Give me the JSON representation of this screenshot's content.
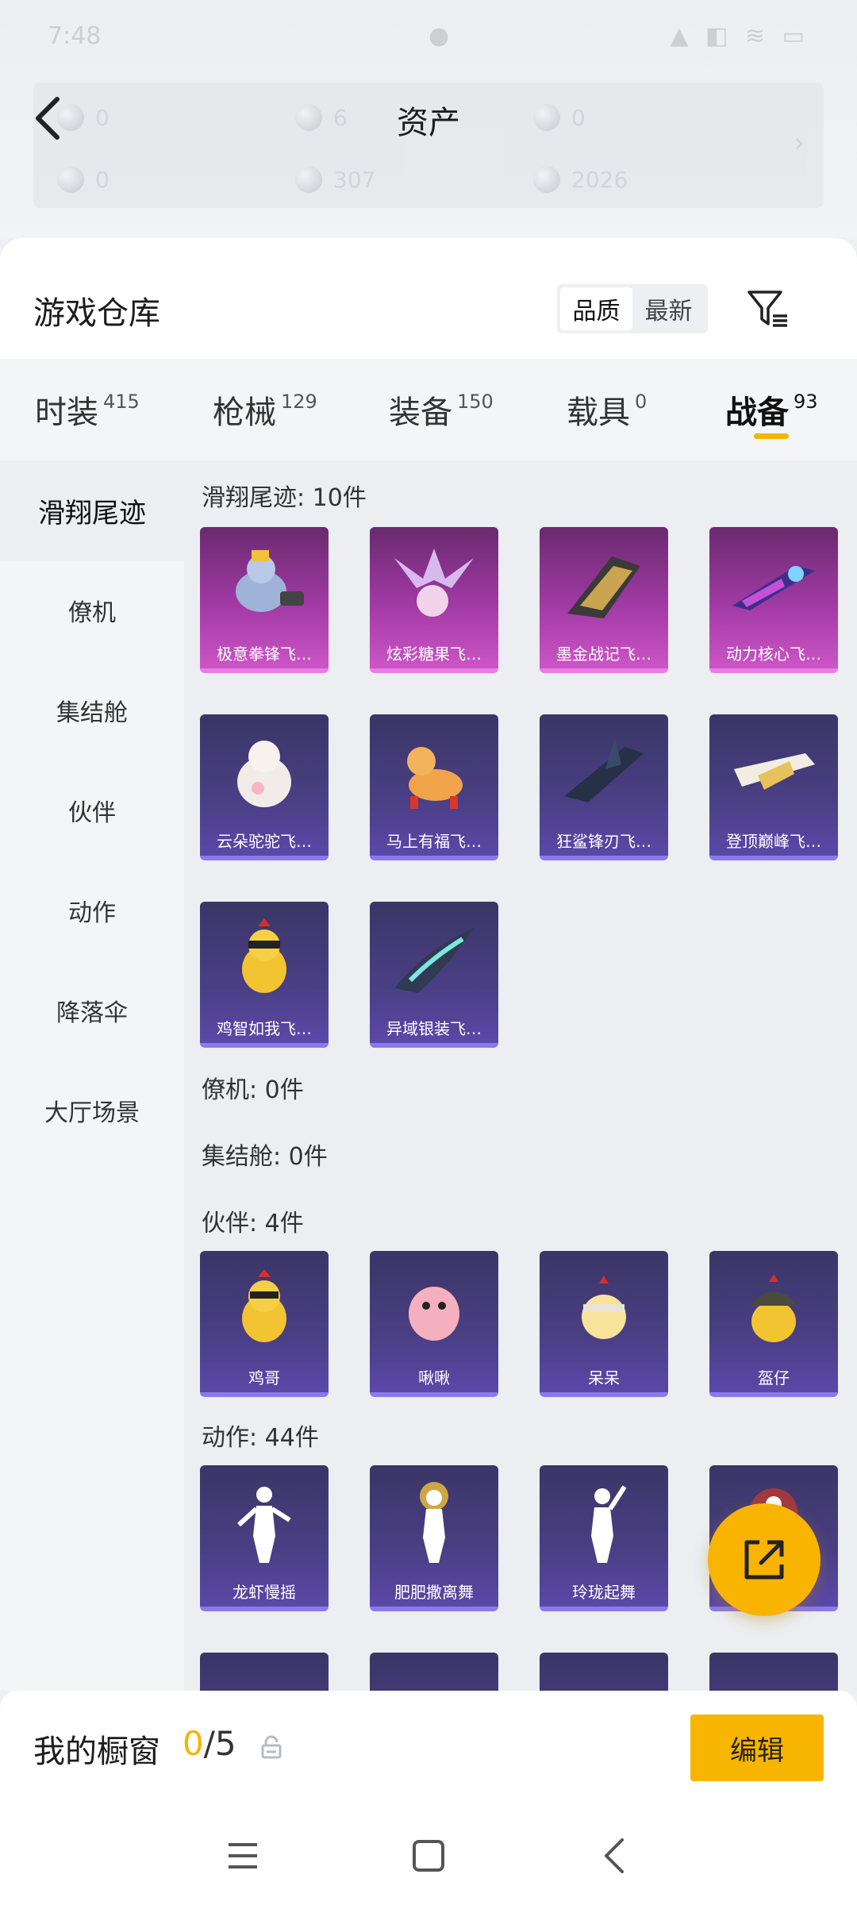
{
  "header": {
    "title": "资产",
    "assets": [
      {
        "value": "0"
      },
      {
        "value": "6"
      },
      {
        "value": "0"
      },
      {
        "value": "0"
      },
      {
        "value": "307"
      },
      {
        "value": "2026"
      }
    ]
  },
  "warehouse": {
    "title": "游戏仓库",
    "sort_options": [
      "品质",
      "最新"
    ],
    "sort_active": "品质"
  },
  "tabs": [
    {
      "label": "时装",
      "count": "415"
    },
    {
      "label": "枪械",
      "count": "129"
    },
    {
      "label": "装备",
      "count": "150"
    },
    {
      "label": "载具",
      "count": "0"
    },
    {
      "label": "战备",
      "count": "93"
    }
  ],
  "sidebar": [
    {
      "label": "滑翔尾迹"
    },
    {
      "label": "僚机"
    },
    {
      "label": "集结舱"
    },
    {
      "label": "伙伴"
    },
    {
      "label": "动作"
    },
    {
      "label": "降落伞"
    },
    {
      "label": "大厅场景"
    }
  ],
  "sections": {
    "trails": {
      "title": "滑翔尾迹: 10件",
      "items": [
        {
          "name": "极意拳锋飞…"
        },
        {
          "name": "炫彩糖果飞…"
        },
        {
          "name": "墨金战记飞…"
        },
        {
          "name": "动力核心飞…"
        },
        {
          "name": "云朵驼驼飞…"
        },
        {
          "name": "马上有福飞…"
        },
        {
          "name": "狂鲨锋刃飞…"
        },
        {
          "name": "登顶巅峰飞…"
        },
        {
          "name": "鸡智如我飞…"
        },
        {
          "name": "异域银装飞…"
        }
      ]
    },
    "wingman": {
      "title": "僚机: 0件"
    },
    "capsule": {
      "title": "集结舱: 0件"
    },
    "partners": {
      "title": "伙伴: 4件",
      "items": [
        {
          "name": "鸡哥"
        },
        {
          "name": "啾啾"
        },
        {
          "name": "呆呆"
        },
        {
          "name": "盔仔"
        }
      ]
    },
    "emotes": {
      "title": "动作: 44件",
      "items": [
        {
          "name": "龙虾慢摇"
        },
        {
          "name": "肥肥撒离舞"
        },
        {
          "name": "玲珑起舞"
        },
        {
          "name": ""
        }
      ]
    }
  },
  "showcase": {
    "label": "我的橱窗",
    "used": "0",
    "total": "/5",
    "edit_label": "编辑"
  },
  "colors": {
    "accent": "#f8b500",
    "card_purple": "#4a3f84",
    "card_epic": "#a13aa4"
  }
}
